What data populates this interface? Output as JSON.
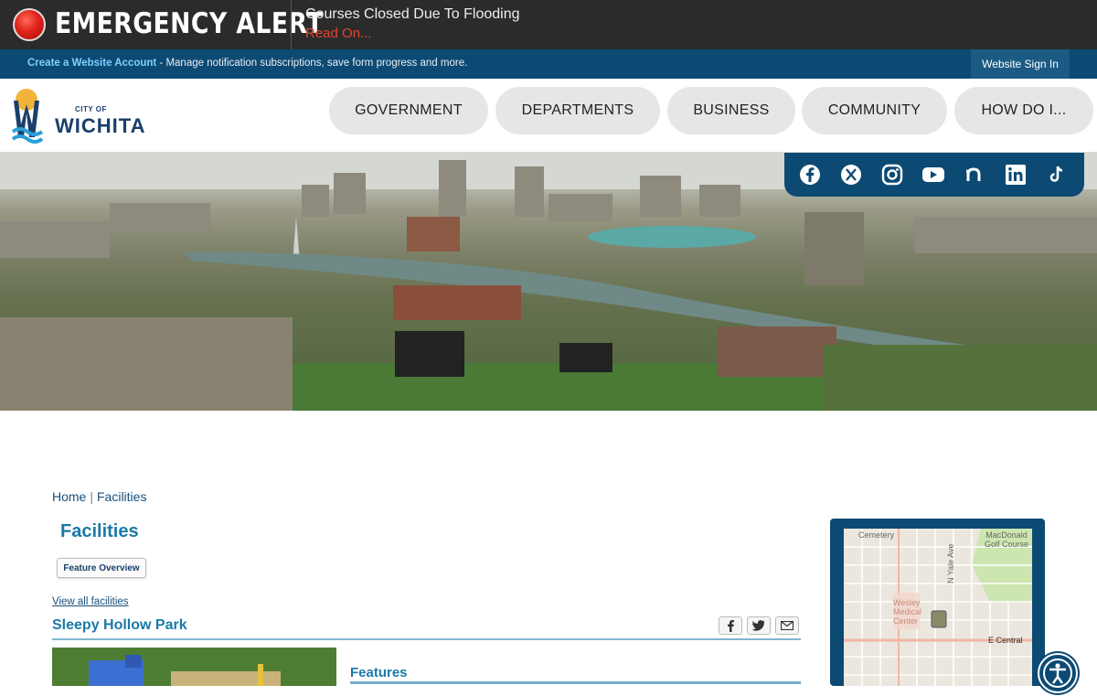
{
  "alert": {
    "title": "EMERGENCY ALERT",
    "message": "Courses Closed Due To Flooding",
    "link": "Read On..."
  },
  "account_bar": {
    "create_link": "Create a Website Account",
    "description": " - Manage notification subscriptions, save form progress and more.",
    "sign_in": "Website Sign In"
  },
  "logo": {
    "small": "CITY OF",
    "big": "WICHITA"
  },
  "nav": [
    "GOVERNMENT",
    "DEPARTMENTS",
    "BUSINESS",
    "COMMUNITY",
    "HOW DO I..."
  ],
  "social": [
    "facebook-icon",
    "x-icon",
    "instagram-icon",
    "youtube-icon",
    "nextdoor-icon",
    "linkedin-icon",
    "tiktok-icon"
  ],
  "breadcrumb": {
    "home": "Home",
    "separator": "|",
    "current": "Facilities"
  },
  "page": {
    "title": "Facilities",
    "feature_button": "Feature Overview",
    "view_all": "View all facilities",
    "facility_name": "Sleepy Hollow Park",
    "features_heading": "Features"
  },
  "map": {
    "labels": [
      "Cemetery",
      "MacDonald Golf Course",
      "N Yale Ave",
      "Wesley Medical Center",
      "E Central"
    ]
  },
  "colors": {
    "alert_bg": "#2b2b2b",
    "alert_red": "#e2452f",
    "brand_navy": "#0d4a73",
    "link_blue": "#1a7aa8"
  }
}
